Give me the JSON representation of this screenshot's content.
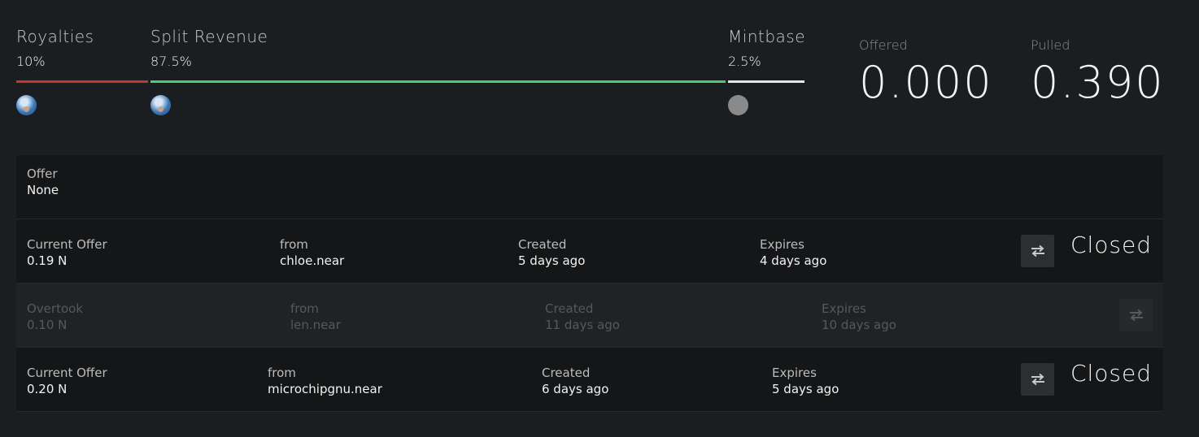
{
  "splits": [
    {
      "label": "Royalties",
      "percent": "10%",
      "bar_color": "#c0392b",
      "avatar": "user-avatar"
    },
    {
      "label": "Split Revenue",
      "percent": "87.5%",
      "bar_color": "#4ccb72",
      "avatar": "user-avatar"
    },
    {
      "label": "Mintbase",
      "percent": "2.5%",
      "bar_color": "#e6e6e6",
      "avatar": "mintbase-avatar"
    }
  ],
  "stats": {
    "offered": {
      "label": "Offered",
      "value": "0.000"
    },
    "pulled": {
      "label": "Pulled",
      "value": "0.390"
    }
  },
  "offer": {
    "label": "Offer",
    "value": "None"
  },
  "rows": [
    {
      "state": "active",
      "offer_label": "Current Offer",
      "amount": "0.19 N",
      "from_label": "from",
      "from": "chloe.near",
      "created_label": "Created",
      "created": "5 days ago",
      "expires_label": "Expires",
      "expires": "4 days ago",
      "status": "Closed",
      "icon": "swap-icon"
    },
    {
      "state": "overtaken",
      "offer_label": "Overtook",
      "amount": "0.10 N",
      "from_label": "from",
      "from": "len.near",
      "created_label": "Created",
      "created": "11 days ago",
      "expires_label": "Expires",
      "expires": "10 days ago",
      "status": "",
      "icon": "swap-icon"
    },
    {
      "state": "active",
      "offer_label": "Current Offer",
      "amount": "0.20 N",
      "from_label": "from",
      "from": "microchipgnu.near",
      "created_label": "Created",
      "created": "6 days ago",
      "expires_label": "Expires",
      "expires": "5 days ago",
      "status": "Closed",
      "icon": "swap-icon"
    }
  ],
  "colors": {
    "background": "#1b1e20",
    "panel": "#141618",
    "muted_row": "#202325"
  }
}
